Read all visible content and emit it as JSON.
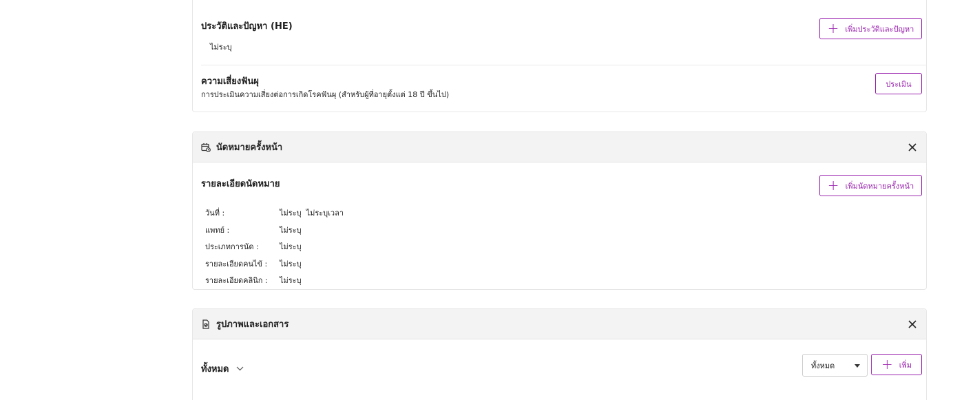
{
  "history": {
    "title": "ประวัติและปัญหา (HE)",
    "value": "ไม่ระบุ",
    "add_button": "เพิ่มประวัติและปัญหา"
  },
  "dental_risk": {
    "title": "ความเสี่ยงฟันผุ",
    "subtitle": "การประเมินความเสี่ยงต่อการเกิดโรคฟันผุ (สำหรับผู้ที่อายุตั้งแต่ 18 ปี ขึ้นไป)",
    "assess_button": "ประเมิน"
  },
  "appointment": {
    "header": "นัดหมายครั้งหน้า",
    "details_title": "รายละเอียดนัดหมาย",
    "add_button": "เพิ่มนัดหมายครั้งหน้า",
    "rows": [
      {
        "label": "วันที่ :",
        "value": "ไม่ระบุ  ไม่ระบุเวลา"
      },
      {
        "label": "แพทย์ :",
        "value": "ไม่ระบุ"
      },
      {
        "label": "ประเภทการนัด :",
        "value": "ไม่ระบุ"
      },
      {
        "label": "รายละเอียดคนไข้ :",
        "value": "ไม่ระบุ"
      },
      {
        "label": "รายละเอียดคลินิก :",
        "value": "ไม่ระบุ"
      }
    ]
  },
  "documents": {
    "header": "รูปภาพและเอกสาร",
    "filter_label": "ทั้งหมด",
    "select_value": "ทั้งหมด",
    "add_button": "เพิ่ม"
  },
  "colors": {
    "accent": "#9c27b0",
    "header_bg": "#f3f3f3"
  },
  "icons": {
    "plus": "plus-icon",
    "close": "close-icon",
    "calendar": "calendar-clock-icon",
    "document": "document-icon",
    "chevron": "chevron-down-icon"
  }
}
